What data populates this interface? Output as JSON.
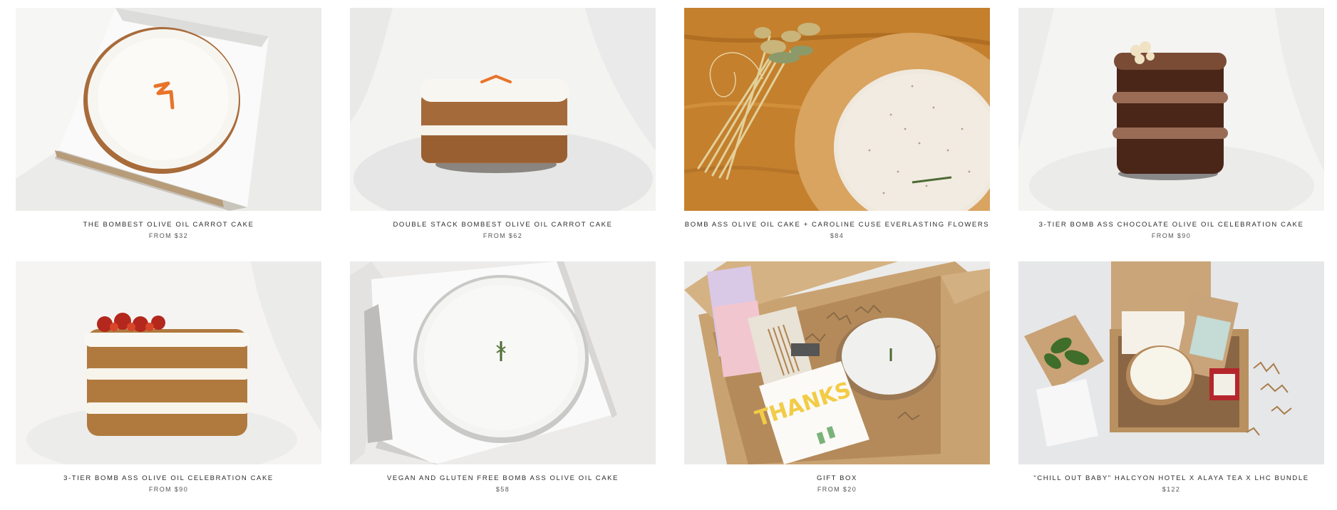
{
  "products": [
    {
      "title": "THE BOMBEST OLIVE OIL CARROT CAKE",
      "price": "FROM $32"
    },
    {
      "title": "DOUBLE STACK BOMBEST OLIVE OIL CARROT CAKE",
      "price": "FROM $62"
    },
    {
      "title": "BOMB ASS OLIVE OIL CAKE + CAROLINE CUSE EVERLASTING FLOWERS",
      "price": "$84"
    },
    {
      "title": "3-TIER BOMB ASS CHOCOLATE OLIVE OIL CELEBRATION CAKE",
      "price": "FROM $90"
    },
    {
      "title": "3-TIER BOMB ASS OLIVE OIL CELEBRATION CAKE",
      "price": "FROM $90"
    },
    {
      "title": "VEGAN AND GLUTEN FREE BOMB ASS OLIVE OIL CAKE",
      "price": "$58"
    },
    {
      "title": "GIFT BOX",
      "price": "FROM $20"
    },
    {
      "title": "\"CHILL OUT BABY\" HALCYON HOTEL X ALAYA TEA X LHC BUNDLE",
      "price": "$122"
    }
  ],
  "gift_card_text": "THANKS"
}
